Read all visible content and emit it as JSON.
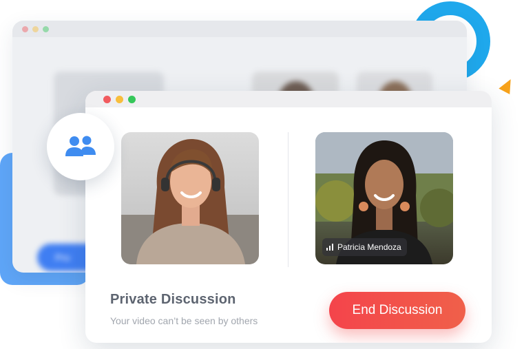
{
  "colors": {
    "accent_blue": "#1fa8ec",
    "badge_icon_blue": "#3f8cf0",
    "end_button_red": "#f4444b",
    "traffic_red": "#f15b5f",
    "traffic_yellow": "#f8be3c",
    "traffic_green": "#36c75a"
  },
  "background_window": {
    "button_label": "Pro"
  },
  "badge": {
    "icon": "people-icon"
  },
  "main_window": {
    "participants": [
      {
        "name": "",
        "role": "local-video"
      },
      {
        "name": "Patricia Mendoza",
        "signal_icon": "signal-bars-icon"
      }
    ],
    "title": "Private Discussion",
    "subtitle": "Your video can’t be seen by others",
    "end_button_label": "End Discussion"
  }
}
